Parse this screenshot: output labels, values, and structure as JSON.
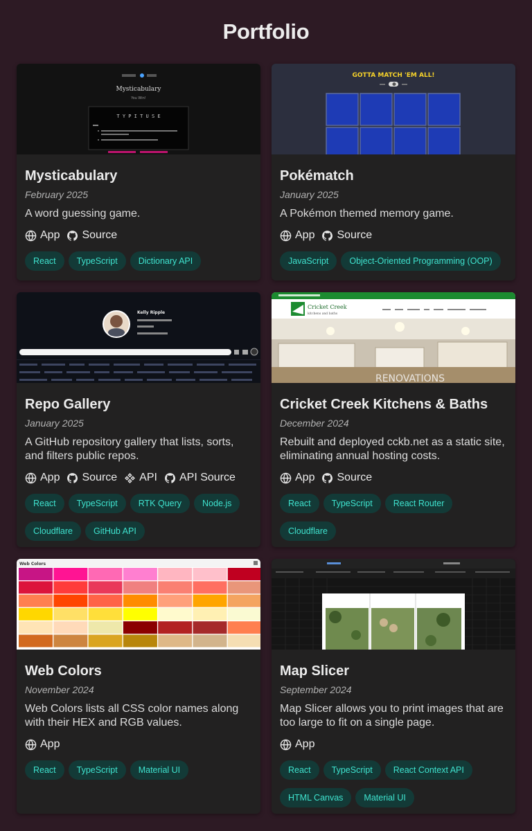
{
  "page": {
    "title": "Portfolio"
  },
  "icons": {
    "app": "globe-icon",
    "source": "github-icon",
    "api": "api-icon"
  },
  "colors": {
    "background": "#2d1a24",
    "card": "#222121",
    "tag_bg": "#133a37",
    "tag_text": "#3fe3cf"
  },
  "projects": [
    {
      "title": "Mysticabulary",
      "date": "February 2025",
      "description": "A word guessing game.",
      "links": [
        "App",
        "Source"
      ],
      "tags": [
        "React",
        "TypeScript",
        "Dictionary API"
      ],
      "thumb": {
        "heading": "Mysticabulary",
        "sub": "You Win!",
        "word": "T Y P I T U S E"
      }
    },
    {
      "title": "Pokématch",
      "date": "January 2025",
      "description": "A Pokémon themed memory game.",
      "links": [
        "App",
        "Source"
      ],
      "tags": [
        "JavaScript",
        "Object-Oriented Programming (OOP)"
      ],
      "thumb": {
        "heading": "GOTTA MATCH 'EM ALL!"
      }
    },
    {
      "title": "Repo Gallery",
      "date": "January 2025",
      "description": "A GitHub repository gallery that lists, sorts, and filters public repos.",
      "links": [
        "App",
        "Source",
        "API",
        "API Source"
      ],
      "tags": [
        "React",
        "TypeScript",
        "RTK Query",
        "Node.js",
        "Cloudflare",
        "GitHub API"
      ],
      "thumb": {
        "name": "Kelly Ripple"
      }
    },
    {
      "title": "Cricket Creek Kitchens & Baths",
      "date": "December 2024",
      "description": "Rebuilt and deployed cckb.net as a static site, eliminating annual hosting costs.",
      "links": [
        "App",
        "Source"
      ],
      "tags": [
        "React",
        "TypeScript",
        "React Router",
        "Cloudflare"
      ],
      "thumb": {
        "brand": "Cricket Creek",
        "brand_sub": "kitchens and baths",
        "overlay": "RENOVATIONS"
      }
    },
    {
      "title": "Web Colors",
      "date": "November 2024",
      "description": "Web Colors lists all CSS color names along with their HEX and RGB values.",
      "links": [
        "App"
      ],
      "tags": [
        "React",
        "TypeScript",
        "Material UI"
      ],
      "thumb": {
        "heading": "Web Colors"
      }
    },
    {
      "title": "Map Slicer",
      "date": "September 2024",
      "description": "Map Slicer allows you to print images that are too large to fit on a single page.",
      "links": [
        "App"
      ],
      "tags": [
        "React",
        "TypeScript",
        "React Context API",
        "HTML Canvas",
        "Material UI"
      ],
      "thumb": {}
    }
  ]
}
